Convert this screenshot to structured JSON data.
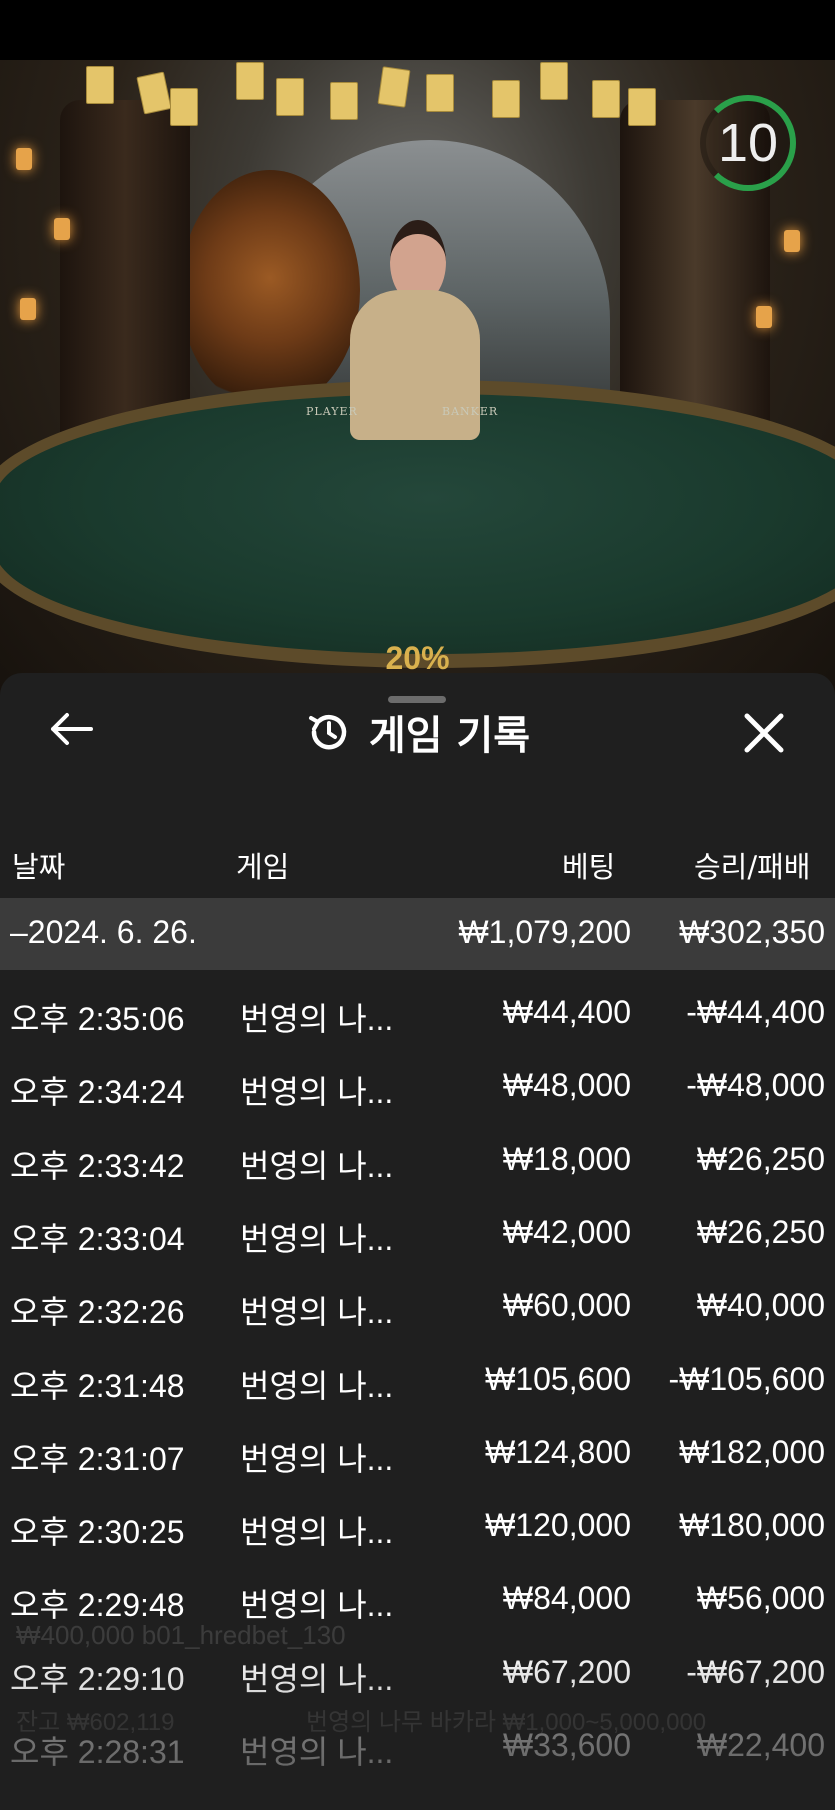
{
  "video": {
    "timer": "10",
    "felt_left": "PLAYER",
    "felt_right": "BANKER",
    "percent": "20%"
  },
  "sheet": {
    "title": "게임 기록",
    "icons": {
      "back": "arrow-left-icon",
      "history": "history-clock-icon",
      "close": "close-icon"
    },
    "columns": {
      "date": "날짜",
      "game": "게임",
      "bet": "베팅",
      "result": "승리/패배"
    },
    "date_group": {
      "label": "–2024. 6. 26.",
      "bet": "₩1,079,200",
      "result": "₩302,350"
    },
    "rows": [
      {
        "time": "오후 2:35:06",
        "game": "번영의 나...",
        "bet": "₩44,400",
        "result": "-₩44,400"
      },
      {
        "time": "오후 2:34:24",
        "game": "번영의 나...",
        "bet": "₩48,000",
        "result": "-₩48,000"
      },
      {
        "time": "오후 2:33:42",
        "game": "번영의 나...",
        "bet": "₩18,000",
        "result": "₩26,250"
      },
      {
        "time": "오후 2:33:04",
        "game": "번영의 나...",
        "bet": "₩42,000",
        "result": "₩26,250"
      },
      {
        "time": "오후 2:32:26",
        "game": "번영의 나...",
        "bet": "₩60,000",
        "result": "₩40,000"
      },
      {
        "time": "오후 2:31:48",
        "game": "번영의 나...",
        "bet": "₩105,600",
        "result": "-₩105,600"
      },
      {
        "time": "오후 2:31:07",
        "game": "번영의 나...",
        "bet": "₩124,800",
        "result": "₩182,000"
      },
      {
        "time": "오후 2:30:25",
        "game": "번영의 나...",
        "bet": "₩120,000",
        "result": "₩180,000"
      },
      {
        "time": "오후 2:29:48",
        "game": "번영의 나...",
        "bet": "₩84,000",
        "result": "₩56,000"
      },
      {
        "time": "오후 2:29:10",
        "game": "번영의 나...",
        "bet": "₩67,200",
        "result": "-₩67,200"
      },
      {
        "time": "오후 2:28:31",
        "game": "번영의 나...",
        "bet": "₩33,600",
        "result": "₩22,400"
      }
    ]
  },
  "background_ghost": {
    "line1": "₩400,000 b01_hredbet_130",
    "line2": "잔고 ₩602,119",
    "line3": "번영의 나무 바카라 ₩1,000~5,000,000"
  }
}
